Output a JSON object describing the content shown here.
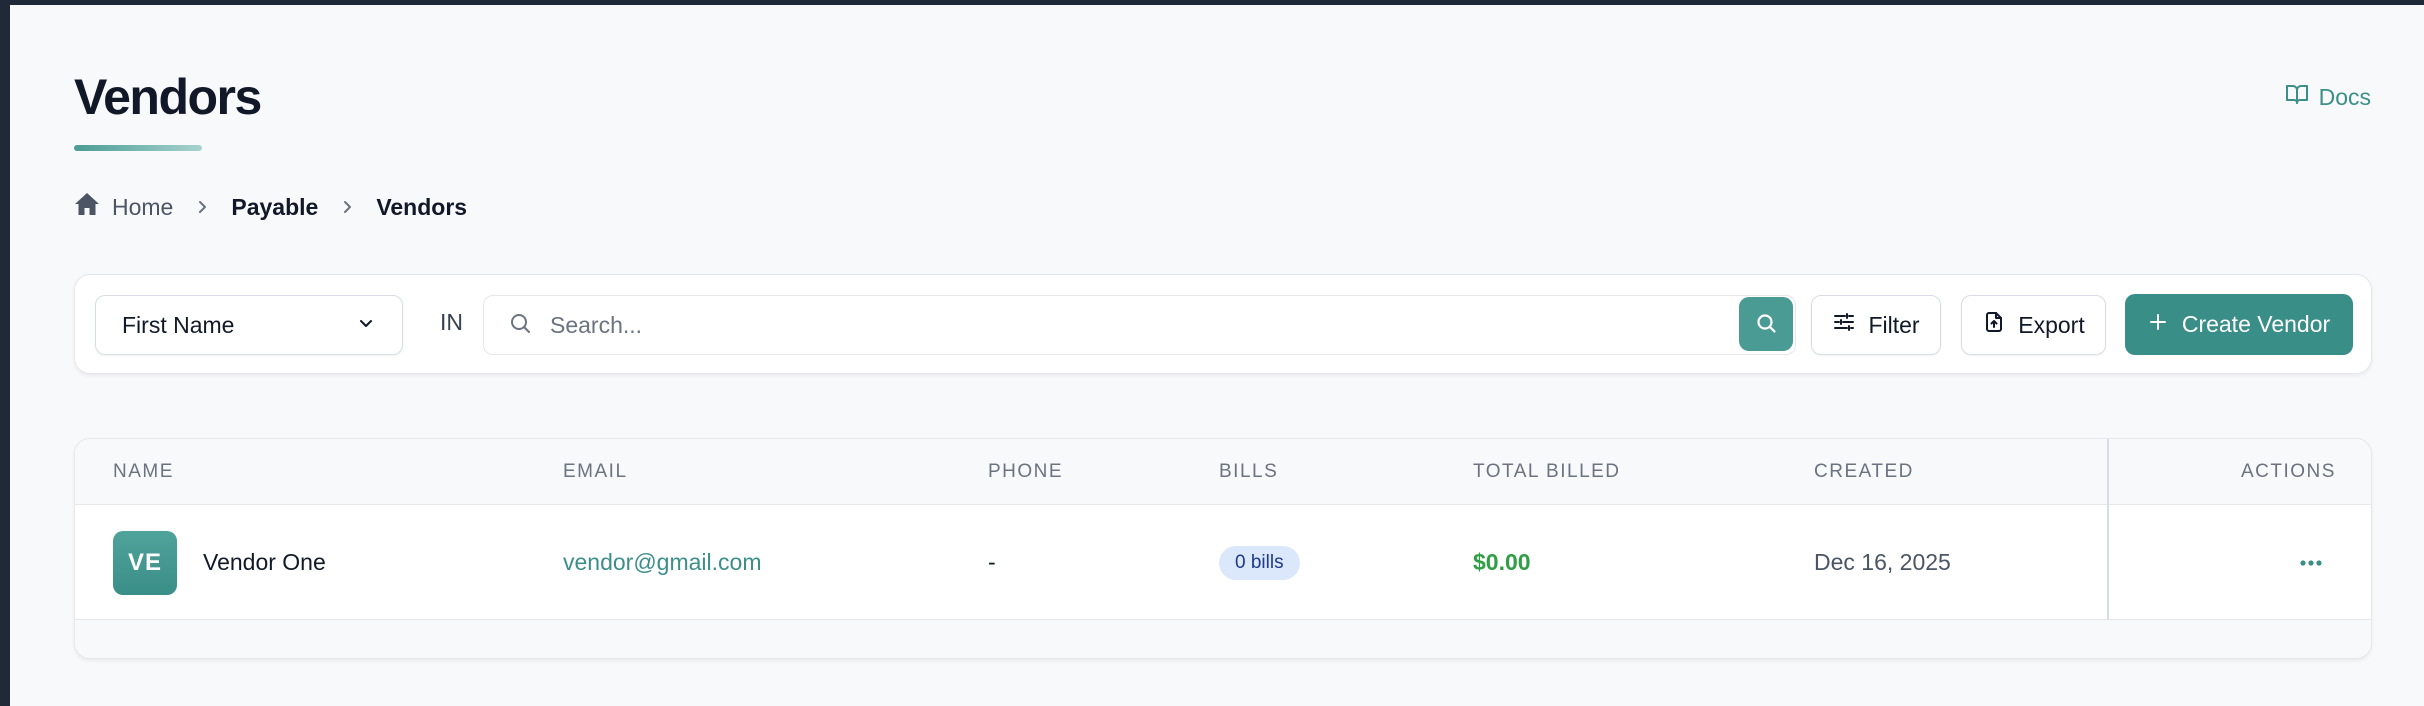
{
  "page": {
    "title": "Vendors",
    "docs_label": "Docs"
  },
  "breadcrumb": {
    "items": [
      "Home",
      "Payable",
      "Vendors"
    ]
  },
  "toolbar": {
    "field_select_value": "First Name",
    "in_label": "IN",
    "search_placeholder": "Search...",
    "filter_label": "Filter",
    "export_label": "Export",
    "create_label": "Create Vendor"
  },
  "table": {
    "columns": [
      "NAME",
      "EMAIL",
      "PHONE",
      "BILLS",
      "TOTAL BILLED",
      "CREATED",
      "ACTIONS"
    ],
    "rows": [
      {
        "initials": "VE",
        "name": "Vendor One",
        "email": "vendor@gmail.com",
        "phone": "-",
        "bills": "0 bills",
        "total_billed": "$0.00",
        "created": "Dec 16, 2025"
      }
    ]
  },
  "colors": {
    "accent": "#3a8e88",
    "link": "#3c8f89",
    "success": "#2f9e44",
    "badge_bg": "#dbe7fb"
  },
  "icons": {
    "docs": "book-open-icon",
    "home": "home-icon",
    "separator": "chevron-right-icon",
    "select": "chevron-down-icon",
    "search": "search-icon",
    "filter": "sliders-icon",
    "export": "file-export-icon",
    "create": "plus-icon",
    "actions": "more-horizontal-icon"
  }
}
